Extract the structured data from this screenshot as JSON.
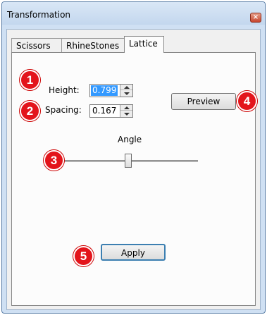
{
  "window": {
    "title": "Transformation",
    "close_glyph": "×"
  },
  "tabs": [
    {
      "label": "Scissors",
      "active": false
    },
    {
      "label": "RhineStones",
      "active": false
    },
    {
      "label": "Lattice",
      "active": true
    }
  ],
  "form": {
    "height_label": "Height:",
    "height_value": "0.799",
    "spacing_label": "Spacing:",
    "spacing_value": "0.167",
    "angle_label": "Angle",
    "angle_slider_value_fraction": 0.5
  },
  "buttons": {
    "preview": "Preview",
    "apply": "Apply"
  },
  "callouts": [
    "1",
    "2",
    "3",
    "4",
    "5"
  ],
  "colors": {
    "callout": "#e3141b",
    "selection": "#3399ff",
    "close": "#c7452d"
  },
  "icons": {
    "close": "close-icon",
    "spin_up": "spin-up-arrow-icon",
    "spin_down": "spin-down-arrow-icon"
  }
}
